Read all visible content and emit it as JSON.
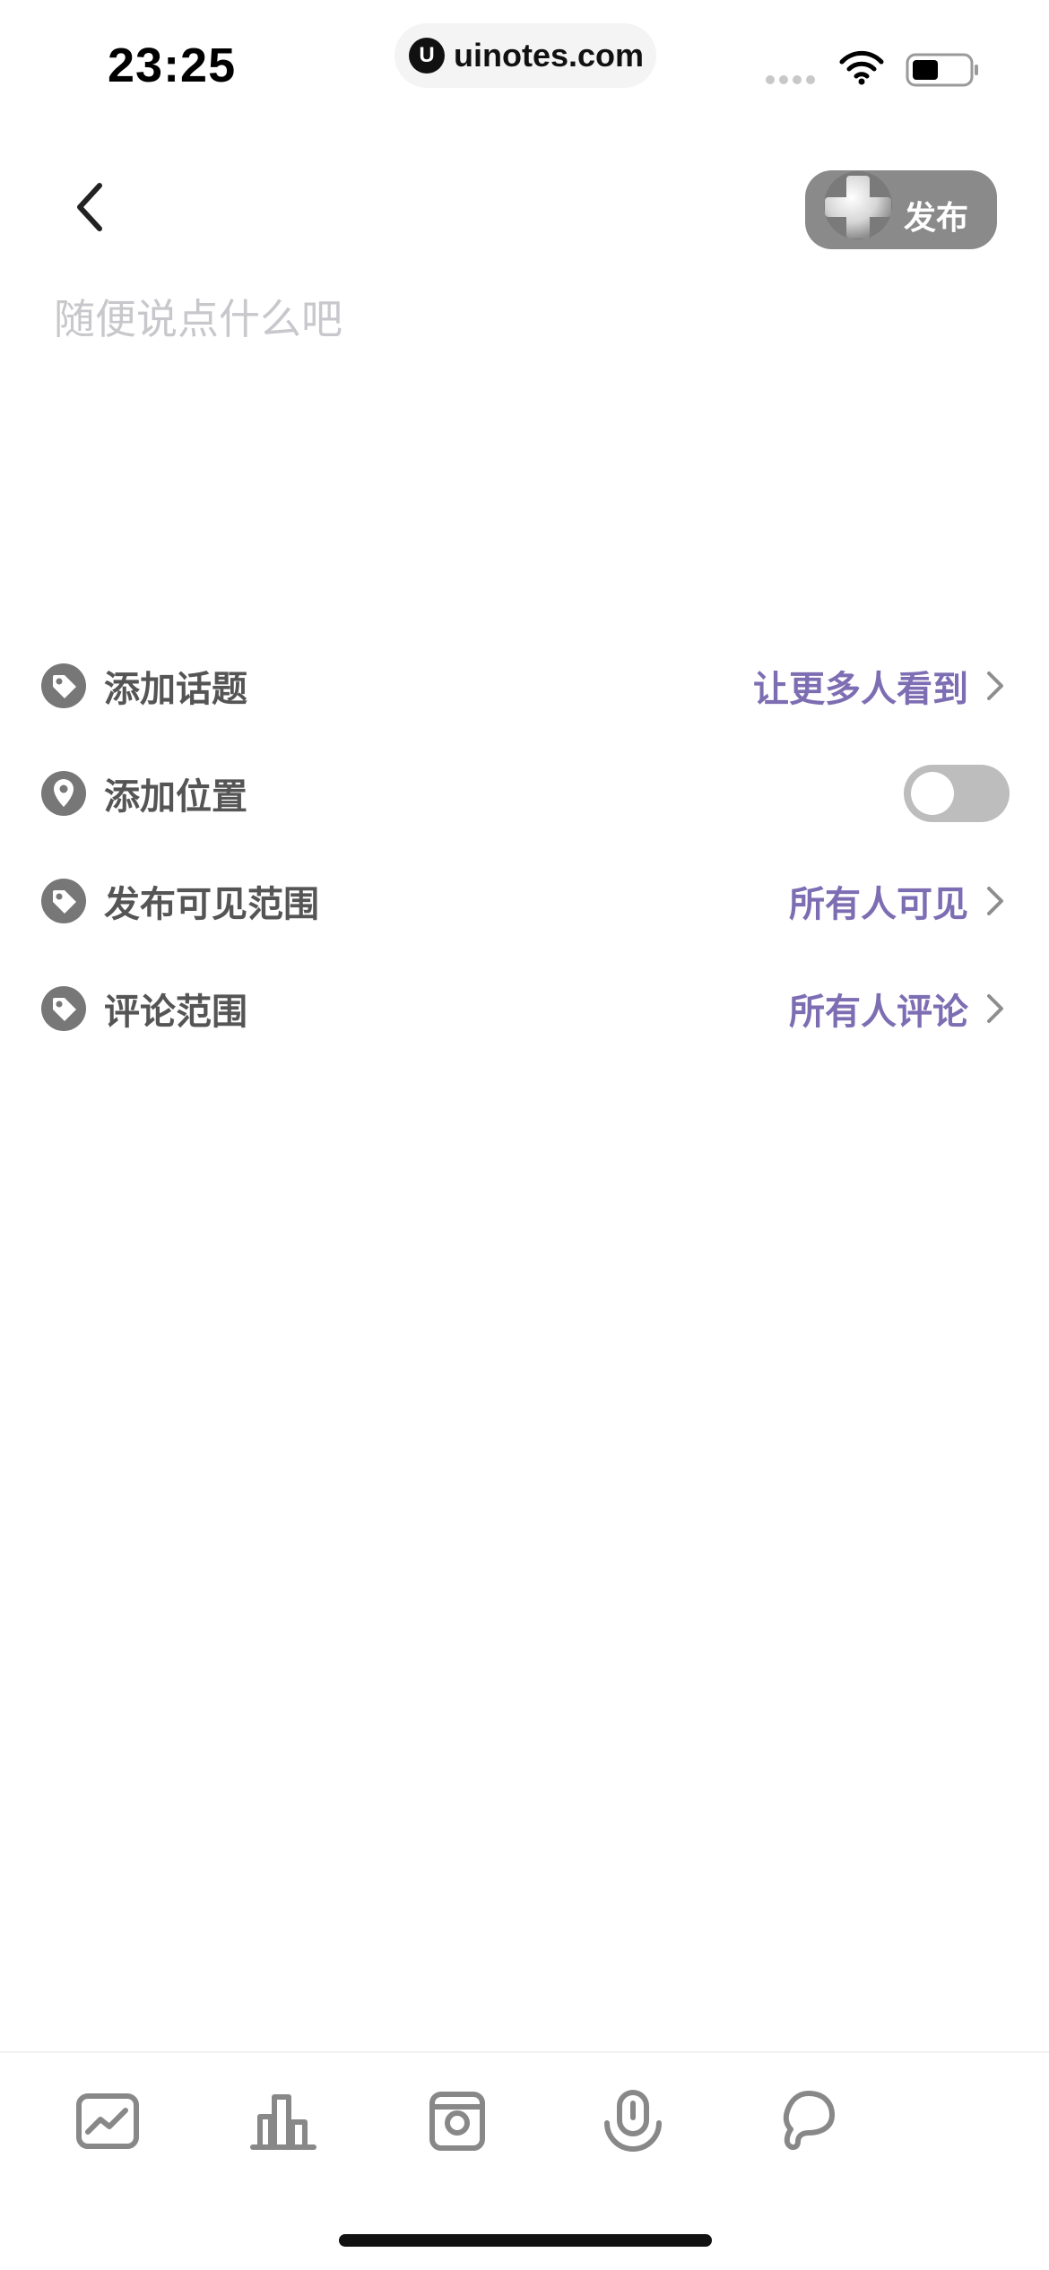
{
  "status_bar": {
    "time": "23:25",
    "url": "uinotes.com",
    "url_logo": "U"
  },
  "header": {
    "publish_label": "发布"
  },
  "composer": {
    "placeholder": "随便说点什么吧",
    "value": ""
  },
  "options": [
    {
      "label": "添加话题",
      "value": "让更多人看到",
      "icon": "tag-icon"
    },
    {
      "label": "添加位置",
      "toggle": false,
      "icon": "location-pin-icon"
    },
    {
      "label": "发布可见范围",
      "value": "所有人可见",
      "icon": "tag-icon"
    },
    {
      "label": "评论范围",
      "value": "所有人评论",
      "icon": "tag-icon"
    }
  ],
  "toolbar": {
    "items": [
      "image-icon",
      "chart-icon",
      "camera-icon",
      "microphone-icon",
      "balloon-icon"
    ]
  },
  "colors": {
    "accent": "#7d6eb3",
    "label": "#555555",
    "placeholder": "#c7c7cc",
    "publish_bg": "#8a8a8a",
    "toggle_off": "#bdbdbd"
  }
}
